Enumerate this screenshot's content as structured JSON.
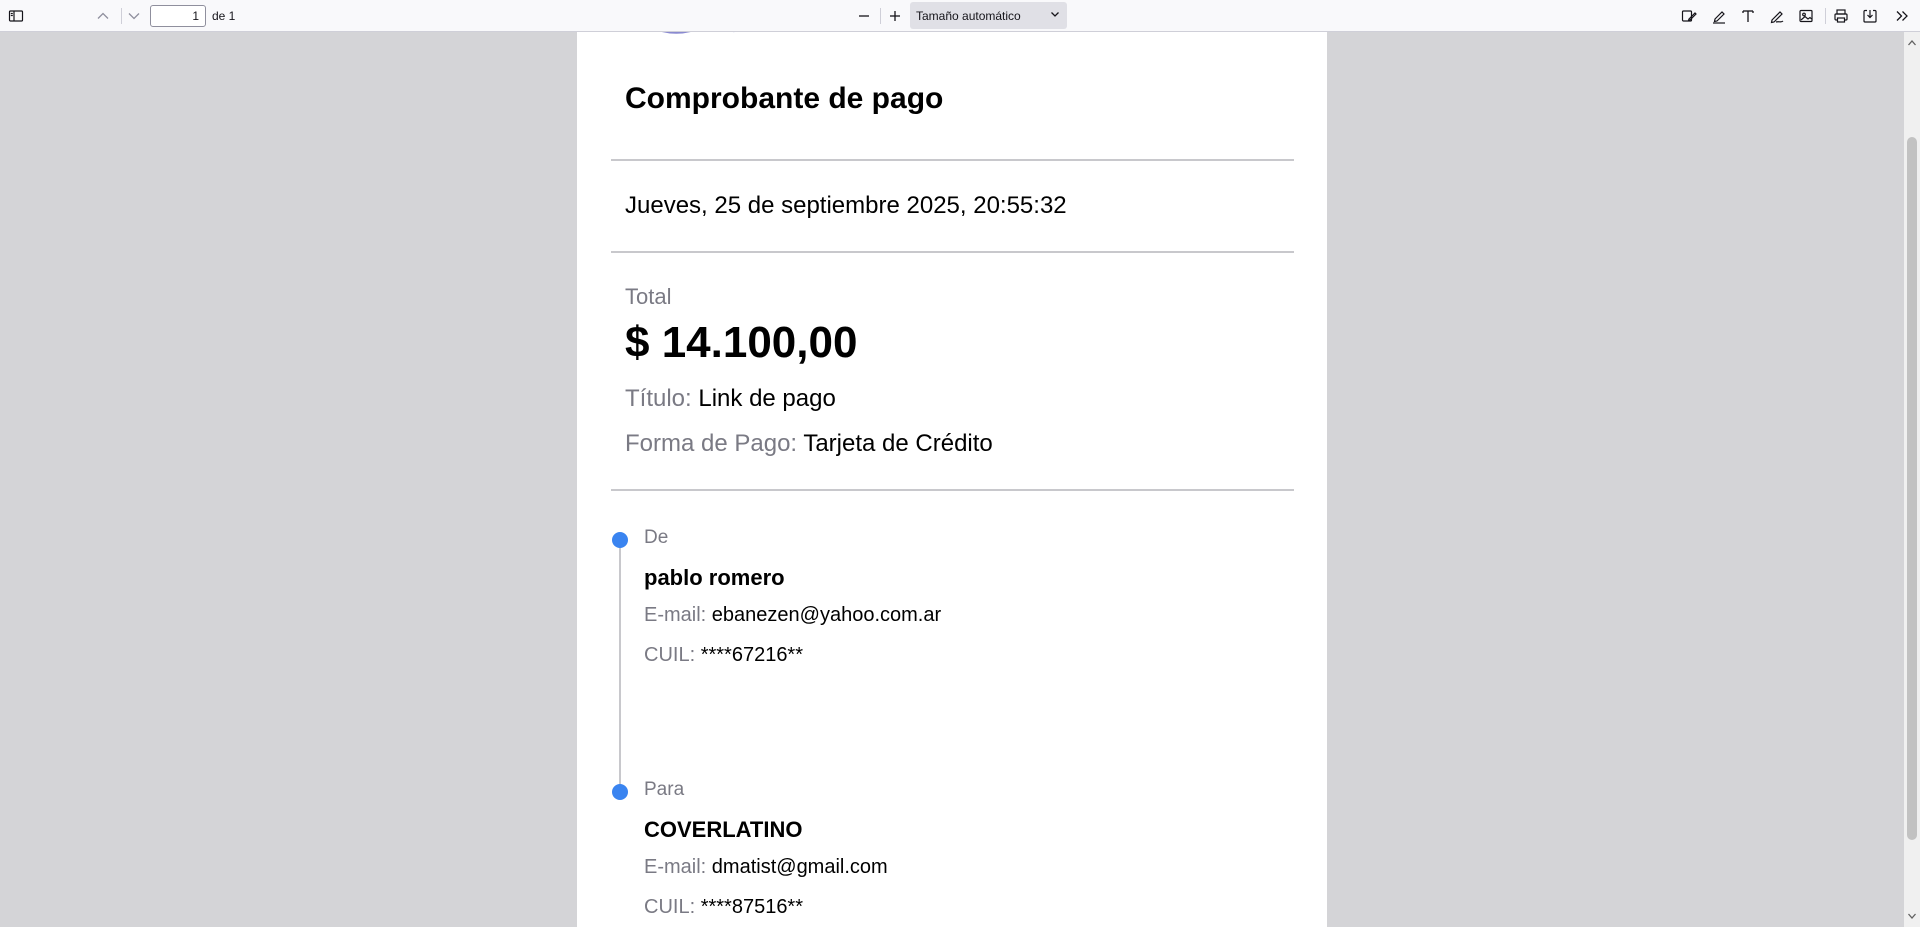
{
  "toolbar": {
    "page_number": "1",
    "page_total": "de 1",
    "zoom_value": "Tamaño automático",
    "icons": [
      "sidebar-toggle-icon",
      "previous-page-icon",
      "next-page-icon",
      "zoom-out-icon",
      "zoom-in-icon",
      "chevron-down-icon",
      "signature-icon",
      "highlight-icon",
      "text-icon",
      "draw-icon",
      "image-icon",
      "print-icon",
      "save-icon",
      "more-tools-icon"
    ]
  },
  "receipt": {
    "title": "Comprobante de pago",
    "date": "Jueves, 25 de septiembre 2025, 20:55:32",
    "total_label": "Total",
    "total_amount": "$ 14.100,00",
    "titulo_label": "Título:",
    "titulo_value": "Link de pago",
    "forma_label": "Forma de Pago:",
    "forma_value": "Tarjeta de Crédito",
    "from": {
      "label": "De",
      "name": "pablo romero",
      "email_label": "E-mail:",
      "email": "ebanezen@yahoo.com.ar",
      "cuil_label": "CUIL:",
      "cuil": "****67216**"
    },
    "to": {
      "label": "Para",
      "name": "COVERLATINO",
      "email_label": "E-mail:",
      "email": "dmatist@gmail.com",
      "cuil_label": "CUIL:",
      "cuil": "****87516**"
    }
  },
  "colors": {
    "accent": "#3a84f0",
    "muted_text": "#7a7a84",
    "viewer_background": "#d4d4d7"
  }
}
